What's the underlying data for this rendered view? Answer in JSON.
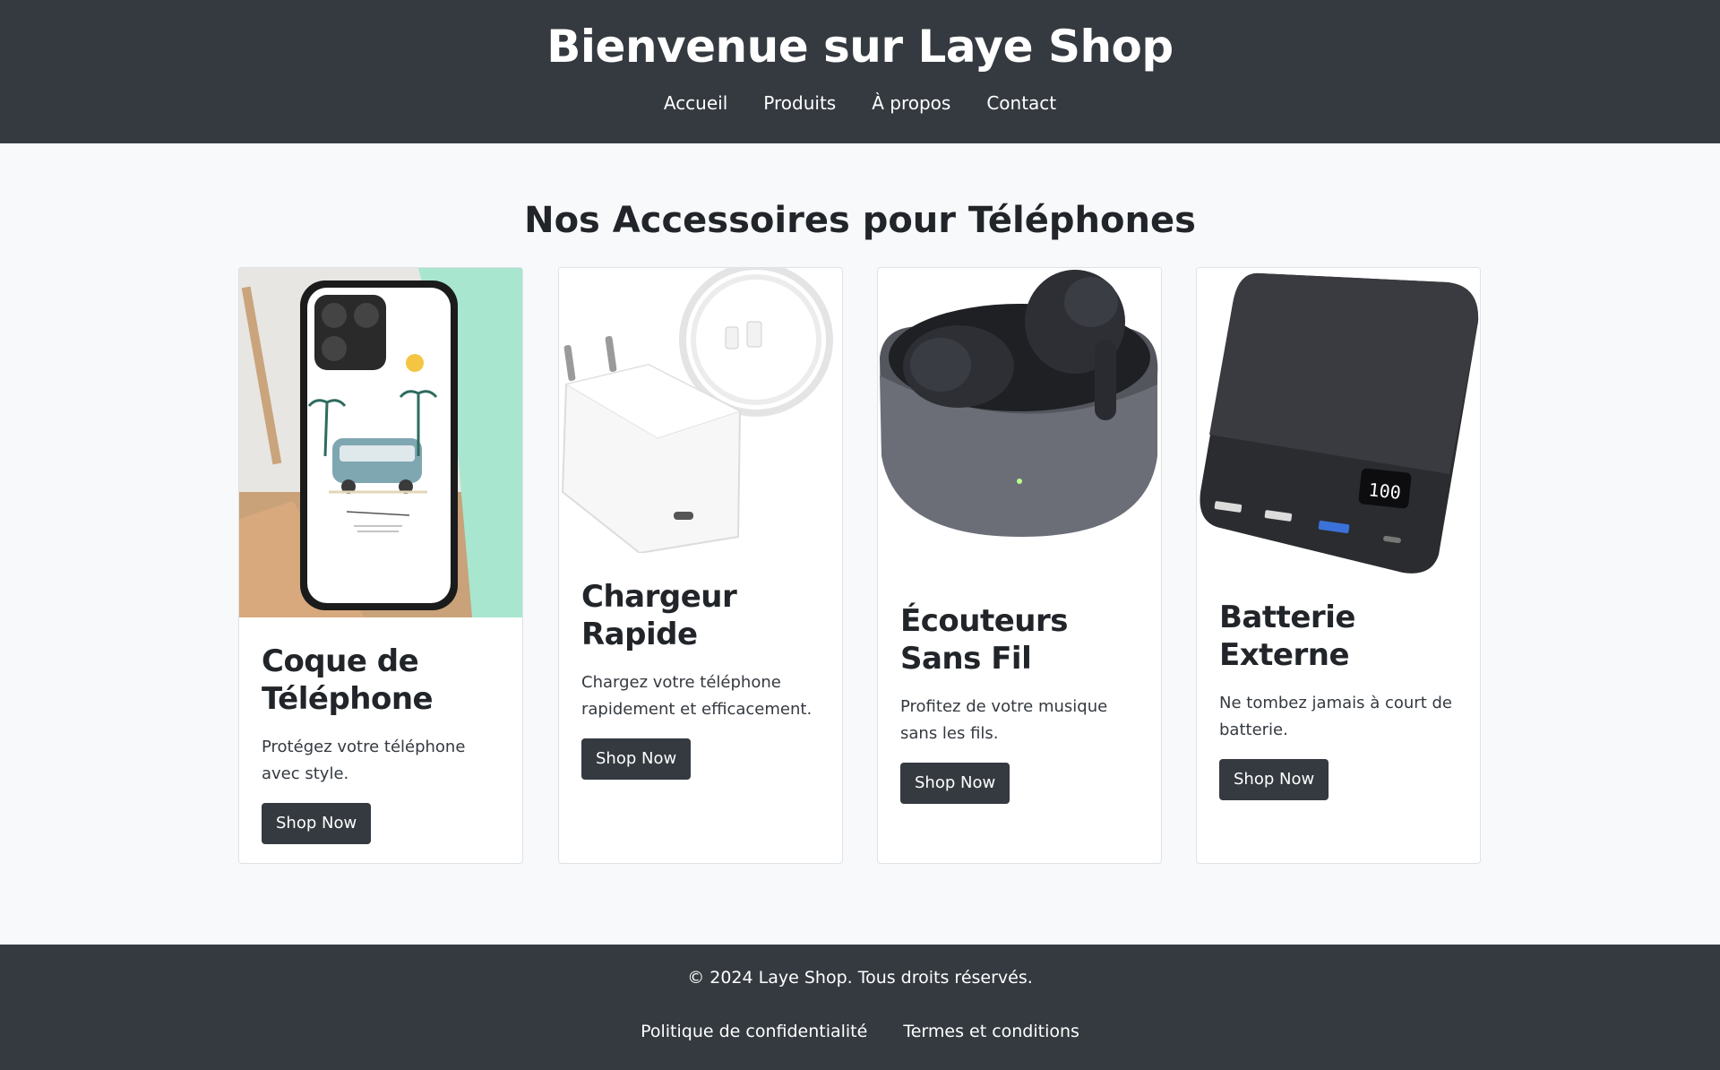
{
  "header": {
    "title": "Bienvenue sur Laye Shop",
    "nav": [
      "Accueil",
      "Produits",
      "À propos",
      "Contact"
    ]
  },
  "main": {
    "section_title": "Nos Accessoires pour Téléphones",
    "products": [
      {
        "name": "Coque de Téléphone",
        "description": "Protégez votre téléphone avec style.",
        "button": "Shop Now",
        "image": "phone-case-image"
      },
      {
        "name": "Chargeur Rapide",
        "description": "Chargez votre téléphone rapidement et efficacement.",
        "button": "Shop Now",
        "image": "charger-image"
      },
      {
        "name": "Écouteurs Sans Fil",
        "description": "Profitez de votre musique sans les fils.",
        "button": "Shop Now",
        "image": "earbuds-image"
      },
      {
        "name": "Batterie Externe",
        "description": "Ne tombez jamais à court de batterie.",
        "button": "Shop Now",
        "image": "power-bank-image"
      }
    ]
  },
  "footer": {
    "copyright": "© 2024 Laye Shop. Tous droits réservés.",
    "links": [
      "Politique de confidentialité",
      "Termes et conditions"
    ]
  },
  "colors": {
    "header_bg": "#343a40",
    "page_bg": "#f8f9fa",
    "button_bg": "#343a40"
  }
}
